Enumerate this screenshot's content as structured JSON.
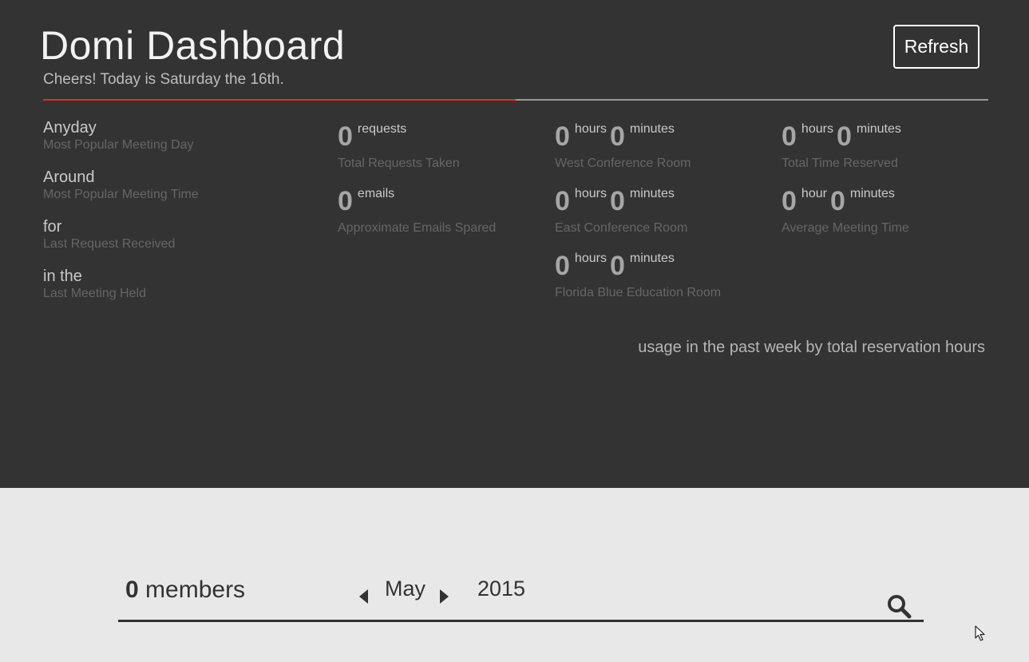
{
  "header": {
    "title": "Domi Dashboard",
    "subtitle": "Cheers! Today is Saturday the 16th.",
    "refresh_label": "Refresh",
    "progress_fraction": 0.5
  },
  "left_stats": [
    {
      "value": "Anyday",
      "label": "Most Popular Meeting Day"
    },
    {
      "value": "Around",
      "label": "Most Popular Meeting Time"
    },
    {
      "value": "for",
      "label": "Last Request Received"
    },
    {
      "value": "in the",
      "label": "Last Meeting Held"
    }
  ],
  "metrics": {
    "requests": {
      "num": "0",
      "unit": "requests",
      "label": "Total Requests Taken"
    },
    "emails": {
      "num": "0",
      "unit": "emails",
      "label": "Approximate Emails Spared"
    },
    "west": {
      "hours": "0",
      "hours_unit": "hours",
      "minutes": "0",
      "minutes_unit": "minutes",
      "label": "West Conference Room"
    },
    "east": {
      "hours": "0",
      "hours_unit": "hours",
      "minutes": "0",
      "minutes_unit": "minutes",
      "label": "East Conference Room"
    },
    "florida": {
      "hours": "0",
      "hours_unit": "hours",
      "minutes": "0",
      "minutes_unit": "minutes",
      "label": "Florida Blue Education Room"
    },
    "total_time": {
      "hours": "0",
      "hours_unit": "hours",
      "minutes": "0",
      "minutes_unit": "minutes",
      "label": "Total Time Reserved"
    },
    "avg_time": {
      "hours": "0",
      "hours_unit": "hour",
      "minutes": "0",
      "minutes_unit": "minutes",
      "label": "Average Meeting Time"
    }
  },
  "usage_caption": "usage in the past week by total reservation hours",
  "footer": {
    "members_count": "0",
    "members_label": "members",
    "month": "May",
    "year": "2015"
  },
  "icons": {
    "search": "search-icon",
    "prev": "triangle-left-icon",
    "next": "triangle-right-icon",
    "cursor": "mouse-pointer-icon"
  },
  "colors": {
    "top_bg": "#333333",
    "bottom_bg": "#e8e8e8",
    "accent": "#d9332a"
  }
}
